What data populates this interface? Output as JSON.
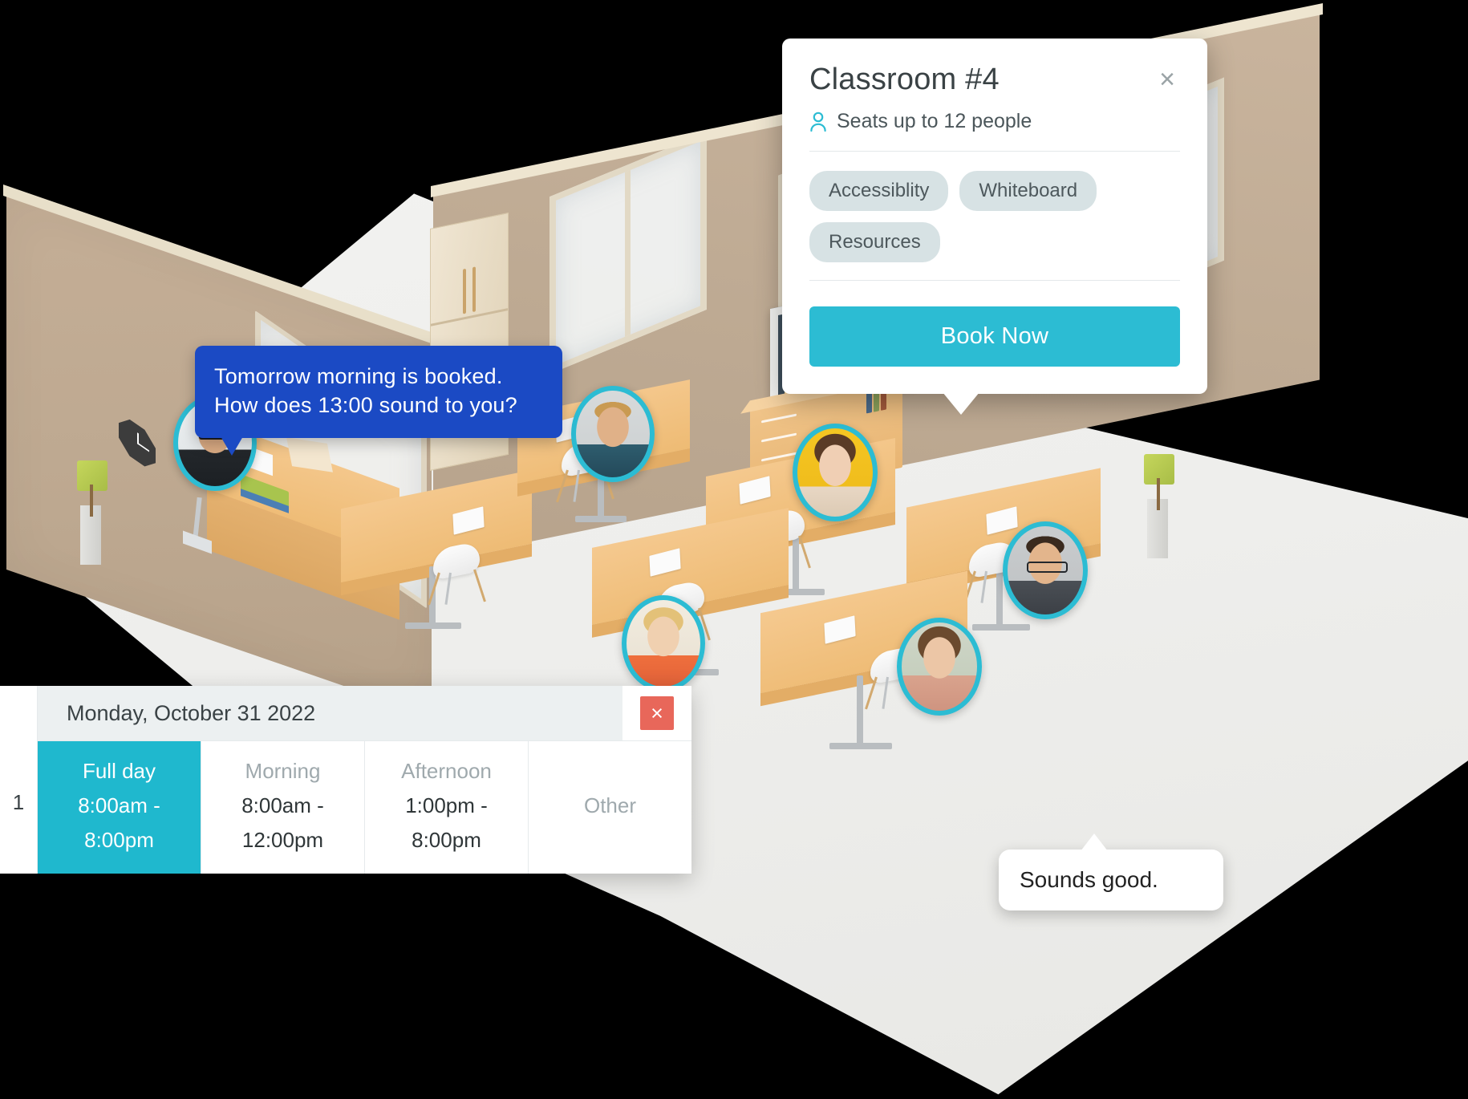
{
  "scene": {
    "title": "classroom-3d-isometric",
    "wall_color": "#bfab94",
    "floor_color": "#efefed",
    "desk_color": "#eebb74",
    "accent_teal": "#2CBCD3"
  },
  "info_card": {
    "title": "Classroom #4",
    "close_label": "×",
    "seats_icon": "person-icon",
    "seats_text": "Seats up to 12 people",
    "chips": [
      "Accessiblity",
      "Whiteboard",
      "Resources"
    ],
    "book_label": "Book Now",
    "button_color": "#2CBCD3",
    "chip_color": "#d7e2e4"
  },
  "bubbles": {
    "agent": {
      "line1": "Tomorrow morning is booked.",
      "line2": "How does 13:00 sound to you?",
      "color": "#1b4ac4"
    },
    "user": {
      "text": "Sounds good.",
      "color": "#ffffff"
    }
  },
  "booking_panel": {
    "row_label": "1",
    "date": "Monday, October 31 2022",
    "close_label": "×",
    "close_color": "#e8675a",
    "active_color": "#1FB8CE",
    "slots": [
      {
        "name": "Full day",
        "time1": "8:00am -",
        "time2": "8:00pm",
        "active": true
      },
      {
        "name": "Morning",
        "time1": "8:00am -",
        "time2": "12:00pm",
        "active": false
      },
      {
        "name": "Afternoon",
        "time1": "1:00pm -",
        "time2": "8:00pm",
        "active": false
      },
      {
        "name": "Other",
        "time1": "",
        "time2": "",
        "active": false
      }
    ]
  },
  "avatars": [
    {
      "name": "avatar-teacher",
      "skin": "#d8a982",
      "hair": "#2b2420",
      "bg": "#eef1f2",
      "shirt": "#23272b"
    },
    {
      "name": "avatar-student-1",
      "skin": "#e0b188",
      "hair": "#c99a52",
      "bg": "#d7dadb",
      "shirt": "#2e5d6e"
    },
    {
      "name": "avatar-student-2",
      "skin": "#f0cfb4",
      "hair": "#5a3b26",
      "bg": "#f4c623",
      "shirt": "#e8d7c4"
    },
    {
      "name": "avatar-student-3",
      "skin": "#e3b58c",
      "hair": "#3a2a1e",
      "bg": "#c9ccce",
      "shirt": "#4a4f55"
    },
    {
      "name": "avatar-student-4",
      "skin": "#f0d0b0",
      "hair": "#e3c178",
      "bg": "#f2ece0",
      "shirt": "#ef6f3c"
    },
    {
      "name": "avatar-student-5",
      "skin": "#ecc6a6",
      "hair": "#6b4a2e",
      "bg": "#cfd6c8",
      "shirt": "#d9a38d"
    }
  ]
}
